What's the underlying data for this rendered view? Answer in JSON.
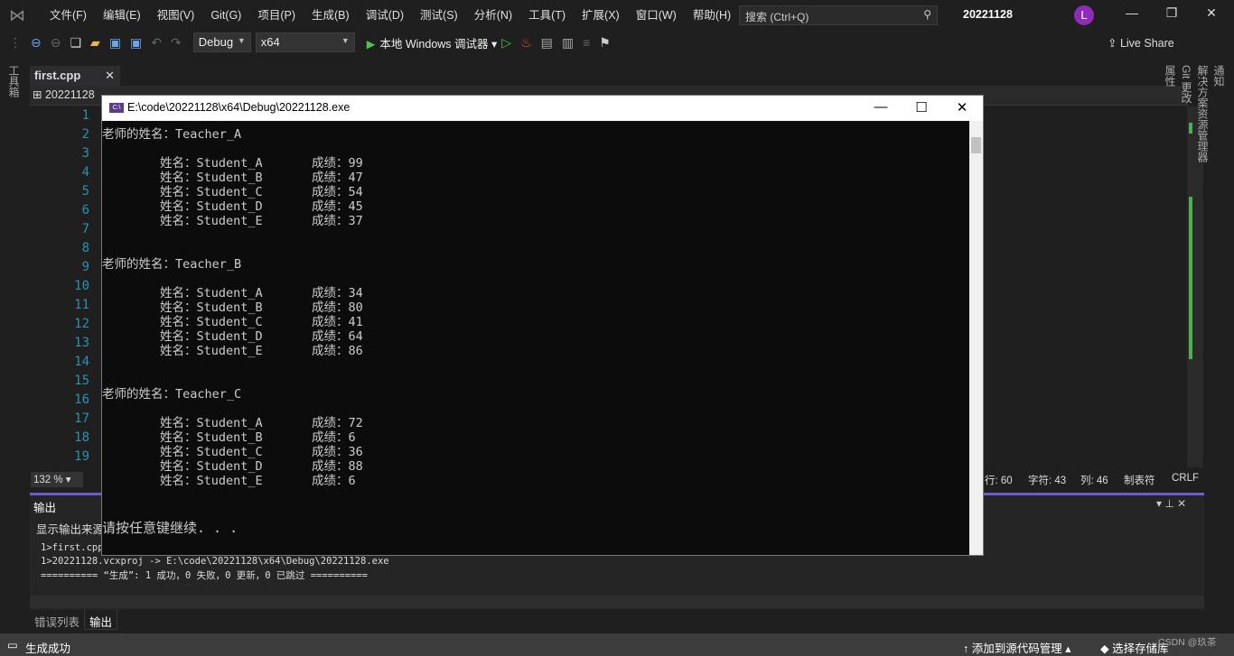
{
  "menubar": {
    "items": [
      "文件(F)",
      "编辑(E)",
      "视图(V)",
      "Git(G)",
      "项目(P)",
      "生成(B)",
      "调试(D)",
      "测试(S)",
      "分析(N)",
      "工具(T)",
      "扩展(X)",
      "窗口(W)",
      "帮助(H)"
    ],
    "search_placeholder": "搜索 (Ctrl+Q)",
    "solution": "20221128",
    "avatar": "L"
  },
  "toolbar": {
    "config": "Debug",
    "platform": "x64",
    "run_label": "本地 Windows 调试器",
    "live_share": "Live Share"
  },
  "left_rail": "工具箱",
  "editor": {
    "tab": "first.cpp",
    "project": "20221128",
    "line_numbers": [
      "1",
      "2",
      "3",
      "4",
      "5",
      "6",
      "7",
      "8",
      "9",
      "10",
      "11",
      "12",
      "13",
      "14",
      "15",
      "16",
      "17",
      "18",
      "19"
    ],
    "zoom": "132 %",
    "row": "行: 60",
    "char": "字符: 43",
    "col": "列: 46",
    "indent": "制表符",
    "eol": "CRLF"
  },
  "right_rail": [
    "通知",
    "解决方案资源管理器",
    "Git 更改",
    "属性"
  ],
  "output": {
    "title": "输出",
    "show_source": "显示输出来源",
    "lines": [
      "1>first.cpp",
      "1>20221128.vcxproj -> E:\\code\\20221128\\x64\\Debug\\20221128.exe",
      "========== “生成”: 1 成功，0 失败，0 更新，0 已跳过 =========="
    ]
  },
  "bottom_tabs": [
    "错误列表",
    "输出"
  ],
  "statusbar": {
    "message": "生成成功",
    "source_control": "添加到源代码管理",
    "repo": "选择存储库",
    "watermark": "CSDN @玖茶"
  },
  "console": {
    "title": "E:\\code\\20221128\\x64\\Debug\\20221128.exe",
    "groups": [
      {
        "teacher": "老师的姓名：Teacher_A",
        "students": [
          [
            "姓名：Student_A",
            "成绩：99"
          ],
          [
            "姓名：Student_B",
            "成绩：47"
          ],
          [
            "姓名：Student_C",
            "成绩：54"
          ],
          [
            "姓名：Student_D",
            "成绩：45"
          ],
          [
            "姓名：Student_E",
            "成绩：37"
          ]
        ]
      },
      {
        "teacher": "老师的姓名：Teacher_B",
        "students": [
          [
            "姓名：Student_A",
            "成绩：34"
          ],
          [
            "姓名：Student_B",
            "成绩：80"
          ],
          [
            "姓名：Student_C",
            "成绩：41"
          ],
          [
            "姓名：Student_D",
            "成绩：64"
          ],
          [
            "姓名：Student_E",
            "成绩：86"
          ]
        ]
      },
      {
        "teacher": "老师的姓名：Teacher_C",
        "students": [
          [
            "姓名：Student_A",
            "成绩：72"
          ],
          [
            "姓名：Student_B",
            "成绩：6"
          ],
          [
            "姓名：Student_C",
            "成绩：36"
          ],
          [
            "姓名：Student_D",
            "成绩：88"
          ],
          [
            "姓名：Student_E",
            "成绩：6"
          ]
        ]
      }
    ],
    "prompt": "请按任意键继续. . ."
  },
  "colors": {
    "accent": "#6b5bd6",
    "line_number": "#2b91af",
    "change_marker": "#4caf50"
  }
}
